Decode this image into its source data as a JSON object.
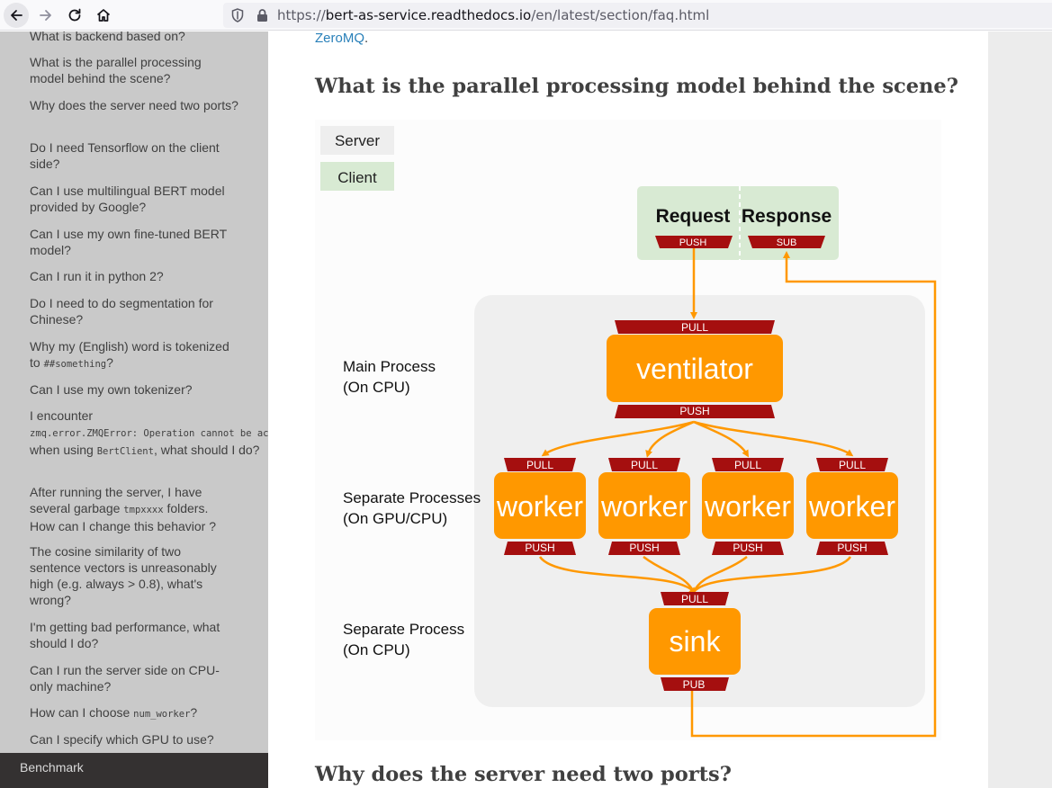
{
  "browser": {
    "url_scheme": "https://",
    "url_host": "bert-as-service.readthedocs.io",
    "url_path": "/en/latest/section/faq.html"
  },
  "sidebar": {
    "items": [
      "What is backend based on?",
      "What is the parallel processing model behind the scene?",
      "Why does the server need two ports?",
      "Do I need Tensorflow on the client side?",
      "Can I use multilingual BERT model provided by Google?",
      "Can I use my own fine-tuned BERT model?",
      "Can I run it in python 2?",
      "Do I need to do segmentation for Chinese?",
      "Can I use my own tokenizer?",
      "I'm getting bad performance, what should I do?",
      "Can I run the server side on CPU-only machine?",
      "Can I specify which GPU to use?"
    ],
    "tokenized": {
      "pre": "Why my (English) word is tokenized to ",
      "code": "##something",
      "post": "?"
    },
    "zmq": {
      "pre": "I encounter ",
      "code1": "zmq.error.ZMQError: Operation cannot be accomplished in current state",
      "mid": " when using ",
      "code2": "BertClient",
      "post": ", what should I do?"
    },
    "tmp": {
      "pre": "After running the server, I have several garbage ",
      "code": "tmpxxxx",
      "post": " folders. How can I change this behavior ?"
    },
    "cosine": "The cosine similarity of two sentence vectors is unreasonably high (e.g. always > 0.8), what's wrong?",
    "numworker": {
      "pre": "How can I choose ",
      "code": "num_worker",
      "post": "?"
    },
    "benchmark": "Benchmark"
  },
  "content": {
    "zeromq_link": "ZeroMQ",
    "zeromq_dot": ".",
    "heading_parallel": "What is the parallel processing model behind the scene?",
    "heading_ports": "Why does the server need two ports?"
  },
  "diagram": {
    "legend_server": "Server",
    "legend_client": "Client",
    "request": "Request",
    "response": "Response",
    "label_main_1": "Main Process",
    "label_main_2": "(On CPU)",
    "label_sep_1": "Separate Processes",
    "label_sep_2": "(On GPU/CPU)",
    "label_sink_1": "Separate Process",
    "label_sink_2": "(On CPU)",
    "ventilator": "ventilator",
    "worker": "worker",
    "sink": "sink",
    "push": "PUSH",
    "pull": "PULL",
    "sub": "SUB",
    "pub": "PUB",
    "colors": {
      "orange": "#ff9800",
      "darkred": "#a50f0f",
      "client_green": "#d8ead3",
      "panel": "#efefef",
      "server_grey": "#eeeeee"
    }
  }
}
